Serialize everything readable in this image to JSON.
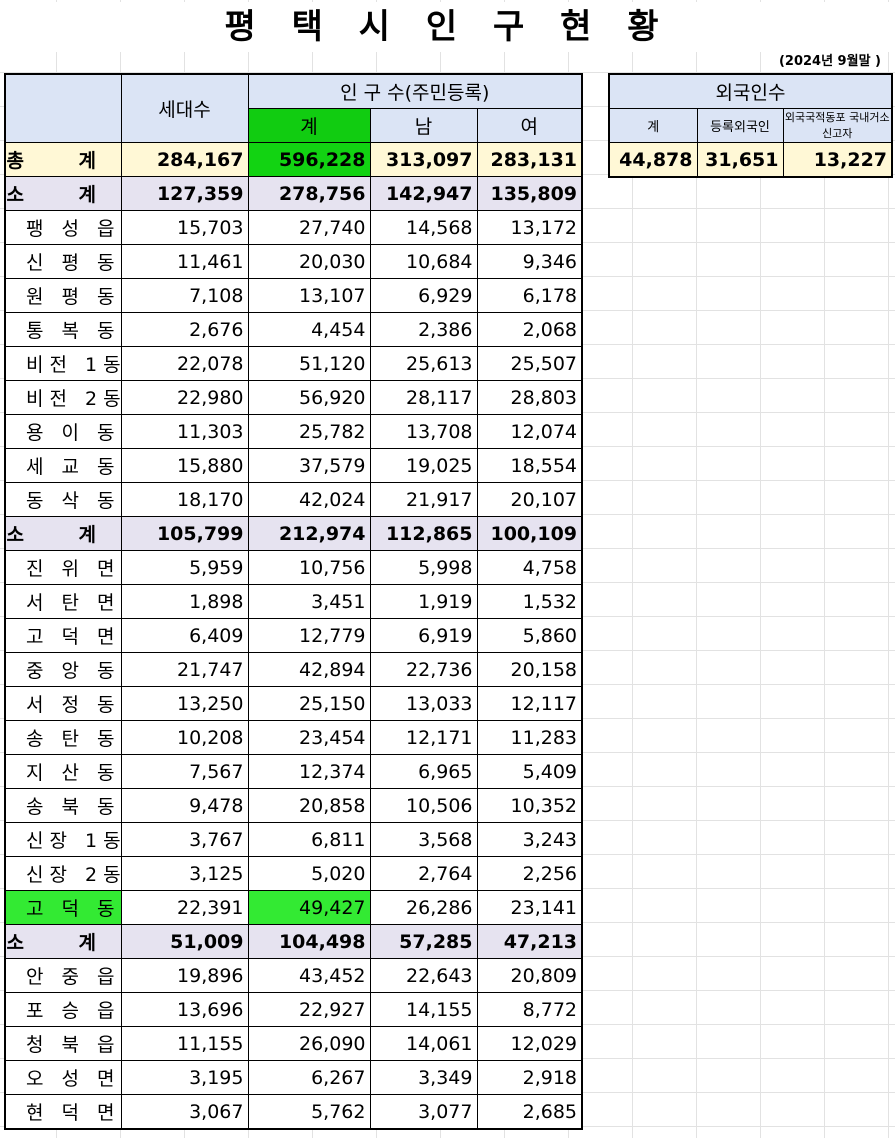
{
  "title": "평 택 시 인 구 현 황",
  "date": "(2024년 9월말 )",
  "main_header": {
    "households": "세대수",
    "population": "인  구  수(주민등록)",
    "total": "계",
    "male": "남",
    "female": "여"
  },
  "grand_total": {
    "label": "총  계",
    "households": "284,167",
    "total": "596,228",
    "male": "313,097",
    "female": "283,131"
  },
  "groups": [
    {
      "subtotal": {
        "label": "소  계",
        "households": "127,359",
        "total": "278,756",
        "male": "142,947",
        "female": "135,809"
      },
      "rows": [
        {
          "name": "팽 성 읍",
          "households": "15,703",
          "total": "27,740",
          "male": "14,568",
          "female": "13,172"
        },
        {
          "name": "신 평 동",
          "households": "11,461",
          "total": "20,030",
          "male": "10,684",
          "female": "9,346"
        },
        {
          "name": "원 평 동",
          "households": "7,108",
          "total": "13,107",
          "male": "6,929",
          "female": "6,178"
        },
        {
          "name": "통 복 동",
          "households": "2,676",
          "total": "4,454",
          "male": "2,386",
          "female": "2,068"
        },
        {
          "name": "비전 1동",
          "households": "22,078",
          "total": "51,120",
          "male": "25,613",
          "female": "25,507"
        },
        {
          "name": "비전 2동",
          "households": "22,980",
          "total": "56,920",
          "male": "28,117",
          "female": "28,803"
        },
        {
          "name": "용 이 동",
          "households": "11,303",
          "total": "25,782",
          "male": "13,708",
          "female": "12,074"
        },
        {
          "name": "세 교 동",
          "households": "15,880",
          "total": "37,579",
          "male": "19,025",
          "female": "18,554"
        },
        {
          "name": "동 삭 동",
          "households": "18,170",
          "total": "42,024",
          "male": "21,917",
          "female": "20,107"
        }
      ]
    },
    {
      "subtotal": {
        "label": "소  계",
        "households": "105,799",
        "total": "212,974",
        "male": "112,865",
        "female": "100,109"
      },
      "rows": [
        {
          "name": "진 위 면",
          "households": "5,959",
          "total": "10,756",
          "male": "5,998",
          "female": "4,758"
        },
        {
          "name": "서 탄 면",
          "households": "1,898",
          "total": "3,451",
          "male": "1,919",
          "female": "1,532"
        },
        {
          "name": "고 덕 면",
          "households": "6,409",
          "total": "12,779",
          "male": "6,919",
          "female": "5,860"
        },
        {
          "name": "중 앙 동",
          "households": "21,747",
          "total": "42,894",
          "male": "22,736",
          "female": "20,158"
        },
        {
          "name": "서 정 동",
          "households": "13,250",
          "total": "25,150",
          "male": "13,033",
          "female": "12,117"
        },
        {
          "name": "송 탄 동",
          "households": "10,208",
          "total": "23,454",
          "male": "12,171",
          "female": "11,283"
        },
        {
          "name": "지 산 동",
          "households": "7,567",
          "total": "12,374",
          "male": "6,965",
          "female": "5,409"
        },
        {
          "name": "송 북 동",
          "households": "9,478",
          "total": "20,858",
          "male": "10,506",
          "female": "10,352"
        },
        {
          "name": "신장 1동",
          "households": "3,767",
          "total": "6,811",
          "male": "3,568",
          "female": "3,243"
        },
        {
          "name": "신장 2동",
          "households": "3,125",
          "total": "5,020",
          "male": "2,764",
          "female": "2,256"
        },
        {
          "name": "고 덕 동",
          "households": "22,391",
          "total": "49,427",
          "male": "26,286",
          "female": "23,141"
        }
      ]
    },
    {
      "subtotal": {
        "label": "소  계",
        "households": "51,009",
        "total": "104,498",
        "male": "57,285",
        "female": "47,213"
      },
      "rows": [
        {
          "name": "안 중 읍",
          "households": "19,896",
          "total": "43,452",
          "male": "22,643",
          "female": "20,809"
        },
        {
          "name": "포 승 읍",
          "households": "13,696",
          "total": "22,927",
          "male": "14,155",
          "female": "8,772"
        },
        {
          "name": "청 북 읍",
          "households": "11,155",
          "total": "26,090",
          "male": "14,061",
          "female": "12,029"
        },
        {
          "name": "오 성 면",
          "households": "3,195",
          "total": "6,267",
          "male": "3,349",
          "female": "2,918"
        },
        {
          "name": "현 덕 면",
          "households": "3,067",
          "total": "5,762",
          "male": "3,077",
          "female": "2,685"
        }
      ]
    }
  ],
  "foreign": {
    "header": "외국인수",
    "col_total": "계",
    "col_registered": "등록외국인",
    "col_compatriot": "외국국적동포 국내거소신고자",
    "total": "44,878",
    "registered": "31,651",
    "compatriot": "13,227"
  },
  "highlight_colors": {
    "header_total": "#11cc11",
    "row_highlight": "#33ea33",
    "grand_total_bg": "#fff8d6",
    "subtotal_bg": "#e6e3f0",
    "header_bg": "#dbe4f5"
  }
}
